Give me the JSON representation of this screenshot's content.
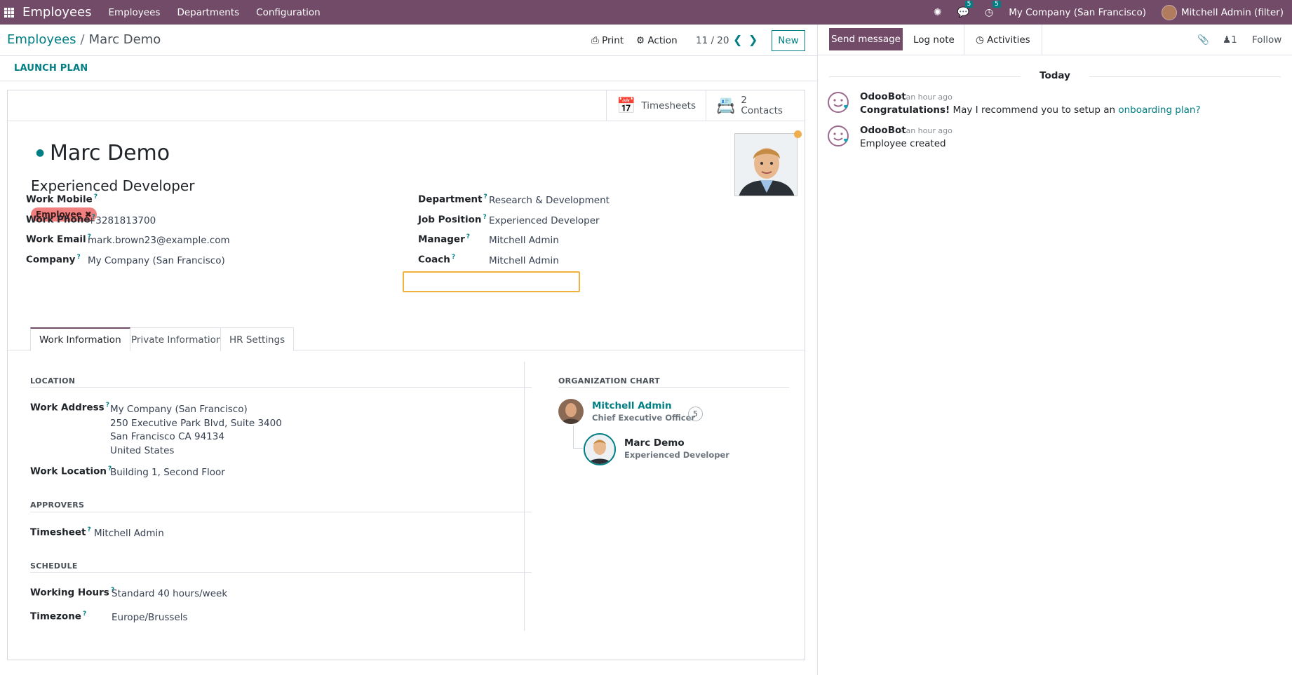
{
  "navbar": {
    "app_name": "Employees",
    "menus": [
      "Employees",
      "Departments",
      "Configuration"
    ],
    "messages_badge": "5",
    "activities_badge": "5",
    "company": "My Company (San Francisco)",
    "user": "Mitchell Admin (filter)",
    "bg_color": "#714B67"
  },
  "control": {
    "breadcrumb_parent": "Employees",
    "breadcrumb_sep": "/",
    "breadcrumb_current": "Marc Demo",
    "print_label": "Print",
    "action_label": "Action",
    "pager": "11 / 20",
    "new_label": "New",
    "launch_plan": "LAUNCH PLAN"
  },
  "smart_buttons": {
    "timesheets": "Timesheets",
    "contacts_count": "2",
    "contacts_label": "Contacts"
  },
  "employee": {
    "name": "Marc Demo",
    "job_title": "Experienced Developer",
    "tag": "Employee"
  },
  "fields_left": [
    {
      "label": "Work Mobile",
      "value": ""
    },
    {
      "label": "Work Phone",
      "value": "+3281813700"
    },
    {
      "label": "Work Email",
      "value": "mark.brown23@example.com"
    },
    {
      "label": "Company",
      "value": "My Company (San Francisco)"
    }
  ],
  "fields_right": [
    {
      "label": "Department",
      "value": "Research & Development"
    },
    {
      "label": "Job Position",
      "value": "Experienced Developer"
    },
    {
      "label": "Manager",
      "value": "Mitchell Admin"
    },
    {
      "label": "Coach",
      "value": "Mitchell Admin"
    }
  ],
  "tabs": [
    "Work Information",
    "Private Information",
    "HR Settings"
  ],
  "location": {
    "title": "LOCATION",
    "work_address_label": "Work Address",
    "address_lines": [
      "My Company (San Francisco)",
      "250 Executive Park Blvd, Suite 3400",
      "San Francisco CA 94134",
      "United States"
    ],
    "work_location_label": "Work Location",
    "work_location_value": "Building 1, Second Floor"
  },
  "approvers": {
    "title": "APPROVERS",
    "timesheet_label": "Timesheet",
    "timesheet_value": "Mitchell Admin"
  },
  "schedule": {
    "title": "SCHEDULE",
    "working_hours_label": "Working Hours",
    "working_hours_value": "Standard 40 hours/week",
    "timezone_label": "Timezone",
    "timezone_value": "Europe/Brussels"
  },
  "org_chart": {
    "title": "ORGANIZATION CHART",
    "manager_name": "Mitchell Admin",
    "manager_title": "Chief Executive Officer",
    "manager_count": "5",
    "employee_name": "Marc Demo",
    "employee_title": "Experienced Developer"
  },
  "chatter": {
    "send_message": "Send message",
    "log_note": "Log note",
    "activities": "Activities",
    "followers_count": "1",
    "follow": "Follow",
    "today": "Today",
    "messages": [
      {
        "author": "OdooBot",
        "time": "- an hour ago",
        "body": "Congratulations!",
        "body_rest": "May I recommend you to setup an",
        "link": "onboarding plan?"
      },
      {
        "author": "OdooBot",
        "time": "- an hour ago",
        "body": "Employee created"
      }
    ]
  }
}
